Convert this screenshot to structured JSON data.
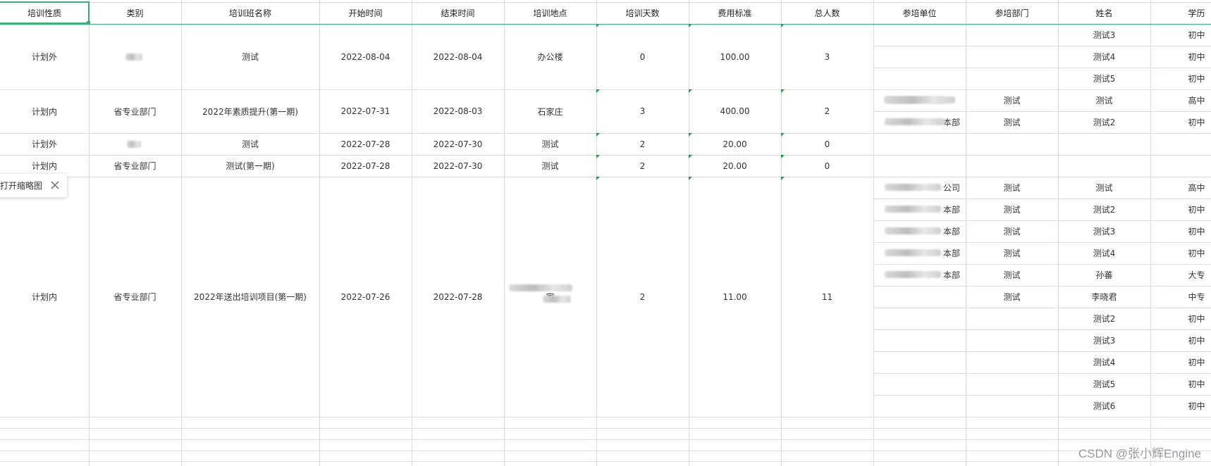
{
  "headers": [
    "培训性质",
    "类别",
    "培训班名称",
    "开始时间",
    "结束时间",
    "培训地点",
    "培训天数",
    "费用标准",
    "总人数",
    "参培单位",
    "参培部门",
    "姓名",
    "学历"
  ],
  "courses": [
    {
      "nature": "计划外",
      "category": "",
      "name": "测试",
      "start": "2022-08-04",
      "end": "2022-08-04",
      "location": "办公楼",
      "days": "0",
      "fee": "100.00",
      "total": "3"
    },
    {
      "nature": "计划内",
      "category": "省专业部门",
      "name": "2022年素质提升(第一期)",
      "start": "2022-07-31",
      "end": "2022-08-03",
      "location": "石家庄",
      "days": "3",
      "fee": "400.00",
      "total": "2"
    },
    {
      "nature": "计划外",
      "category": "",
      "name": "测试",
      "start": "2022-07-28",
      "end": "2022-07-30",
      "location": "测试",
      "days": "2",
      "fee": "20.00",
      "total": "0"
    },
    {
      "nature": "计划内",
      "category": "省专业部门",
      "name": "测试(第一期)",
      "start": "2022-07-28",
      "end": "2022-07-30",
      "location": "测试",
      "days": "2",
      "fee": "20.00",
      "total": "0"
    },
    {
      "nature": "计划内",
      "category": "省专业部门",
      "name": "2022年送出培训项目(第一期)",
      "start": "2022-07-26",
      "end": "2022-07-28",
      "location": "家",
      "days": "2",
      "fee": "11.00",
      "total": "11"
    }
  ],
  "participants": [
    {
      "unit": "",
      "dept": "",
      "person": "测试3",
      "edu": "初中"
    },
    {
      "unit": "",
      "dept": "",
      "person": "测试4",
      "edu": "初中"
    },
    {
      "unit": "",
      "dept": "",
      "person": "测试5",
      "edu": "初中"
    },
    {
      "unit": "",
      "dept": "测试",
      "person": "测试",
      "edu": "高中"
    },
    {
      "unit": "本部",
      "dept": "测试",
      "person": "测试2",
      "edu": "初中"
    },
    {
      "unit": "",
      "dept": "",
      "person": "",
      "edu": ""
    },
    {
      "unit": "",
      "dept": "",
      "person": "",
      "edu": ""
    },
    {
      "unit": "公司",
      "dept": "测试",
      "person": "测试",
      "edu": "高中"
    },
    {
      "unit": "本部",
      "dept": "测试",
      "person": "测试2",
      "edu": "初中"
    },
    {
      "unit": "本部",
      "dept": "测试",
      "person": "测试3",
      "edu": "初中"
    },
    {
      "unit": "本部",
      "dept": "测试",
      "person": "测试4",
      "edu": "初中"
    },
    {
      "unit": "本部",
      "dept": "测试",
      "person": "孙蕃",
      "edu": "大专"
    },
    {
      "unit": "",
      "dept": "测试",
      "person": "李晓君",
      "edu": "中专"
    },
    {
      "unit": "",
      "dept": "",
      "person": "测试2",
      "edu": "初中"
    },
    {
      "unit": "",
      "dept": "",
      "person": "测试3",
      "edu": "初中"
    },
    {
      "unit": "",
      "dept": "",
      "person": "测试4",
      "edu": "初中"
    },
    {
      "unit": "",
      "dept": "",
      "person": "测试5",
      "edu": "初中"
    },
    {
      "unit": "",
      "dept": "",
      "person": "测试6",
      "edu": "初中"
    }
  ],
  "thumbnail_tip": {
    "label": "打开缩略图"
  },
  "watermark": "CSDN @张小辉Engine",
  "colors": {
    "grid": "#d8dbe6",
    "selection": "#35b07a",
    "marker": "#1f9d3a",
    "text": "#333333"
  }
}
